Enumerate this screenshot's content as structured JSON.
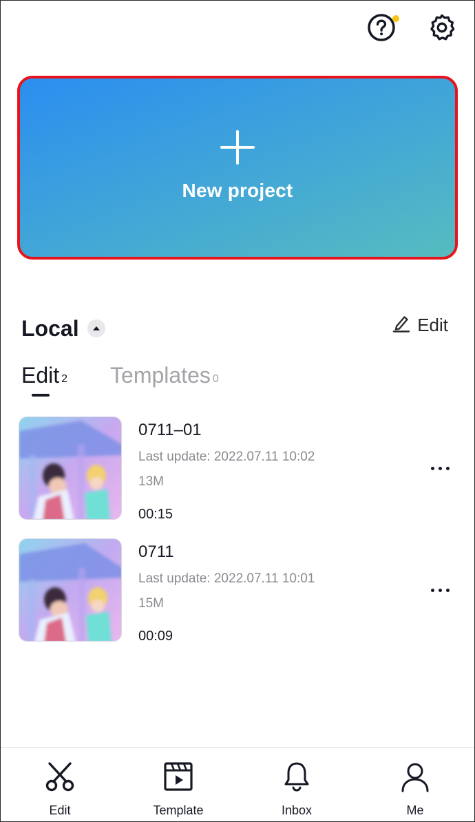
{
  "header": {
    "help_icon": "question-circle-icon",
    "settings_icon": "gear-icon",
    "notification_dot_color": "#f5c518"
  },
  "new_project": {
    "label": "New project",
    "icon": "plus-icon",
    "gradient_start": "#2b8ef0",
    "gradient_end": "#56bcc0",
    "border_color": "#e8141b"
  },
  "local_section": {
    "title": "Local",
    "collapse_icon": "caret-up-icon",
    "edit_label": "Edit",
    "edit_icon": "pencil-icon"
  },
  "tabs": [
    {
      "label": "Edit",
      "count": "2",
      "active": true
    },
    {
      "label": "Templates",
      "count": "0",
      "active": false
    }
  ],
  "projects": [
    {
      "name": "0711–01",
      "last_update": "Last update: 2022.07.11 10:02",
      "size": "13M",
      "duration": "00:15"
    },
    {
      "name": "0711",
      "last_update": "Last update: 2022.07.11 10:01",
      "size": "15M",
      "duration": "00:09"
    }
  ],
  "bottom_nav": [
    {
      "label": "Edit",
      "icon": "scissors-icon"
    },
    {
      "label": "Template",
      "icon": "template-clapper-icon"
    },
    {
      "label": "Inbox",
      "icon": "bell-icon"
    },
    {
      "label": "Me",
      "icon": "person-icon"
    }
  ]
}
